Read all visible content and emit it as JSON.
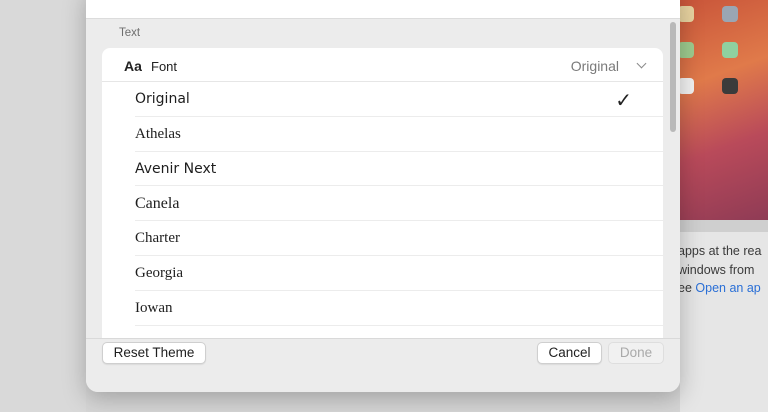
{
  "background": {
    "help_lines": [
      "apps at the rea",
      "windows from",
      "ee"
    ],
    "help_link": "Open an ap"
  },
  "dialog": {
    "section_label": "Text",
    "font_header": {
      "icon": "Aa",
      "title": "Font",
      "value": "Original"
    },
    "font_options": [
      {
        "label": "Original",
        "selected": true
      },
      {
        "label": "Athelas",
        "selected": false
      },
      {
        "label": "Avenir Next",
        "selected": false
      },
      {
        "label": "Canela",
        "selected": false
      },
      {
        "label": "Charter",
        "selected": false
      },
      {
        "label": "Georgia",
        "selected": false
      },
      {
        "label": "Iowan",
        "selected": false
      }
    ],
    "check_glyph": "✓",
    "footer": {
      "reset_label": "Reset Theme",
      "cancel_label": "Cancel",
      "done_label": "Done"
    }
  }
}
